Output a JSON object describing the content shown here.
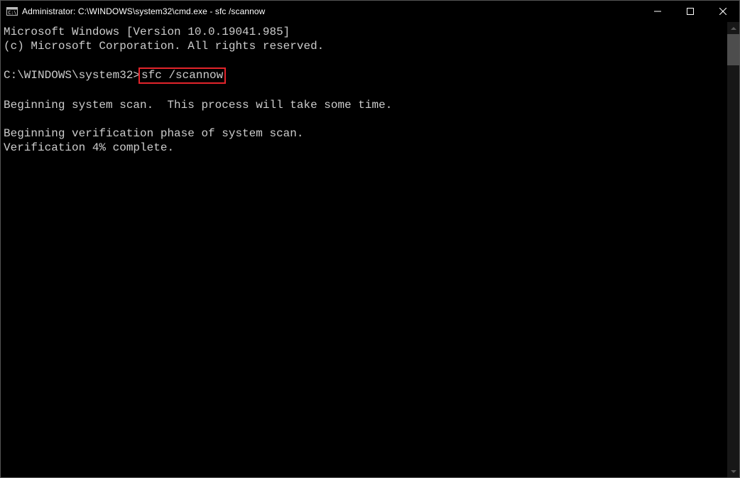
{
  "title": "Administrator: C:\\WINDOWS\\system32\\cmd.exe - sfc  /scannow",
  "lines": {
    "l1": "Microsoft Windows [Version 10.0.19041.985]",
    "l2": "(c) Microsoft Corporation. All rights reserved.",
    "blank1": "",
    "prompt": "C:\\WINDOWS\\system32>",
    "cmd": "sfc /scannow",
    "blank2": "",
    "l3": "Beginning system scan.  This process will take some time.",
    "blank3": "",
    "l4": "Beginning verification phase of system scan.",
    "l5": "Verification 4% complete."
  }
}
